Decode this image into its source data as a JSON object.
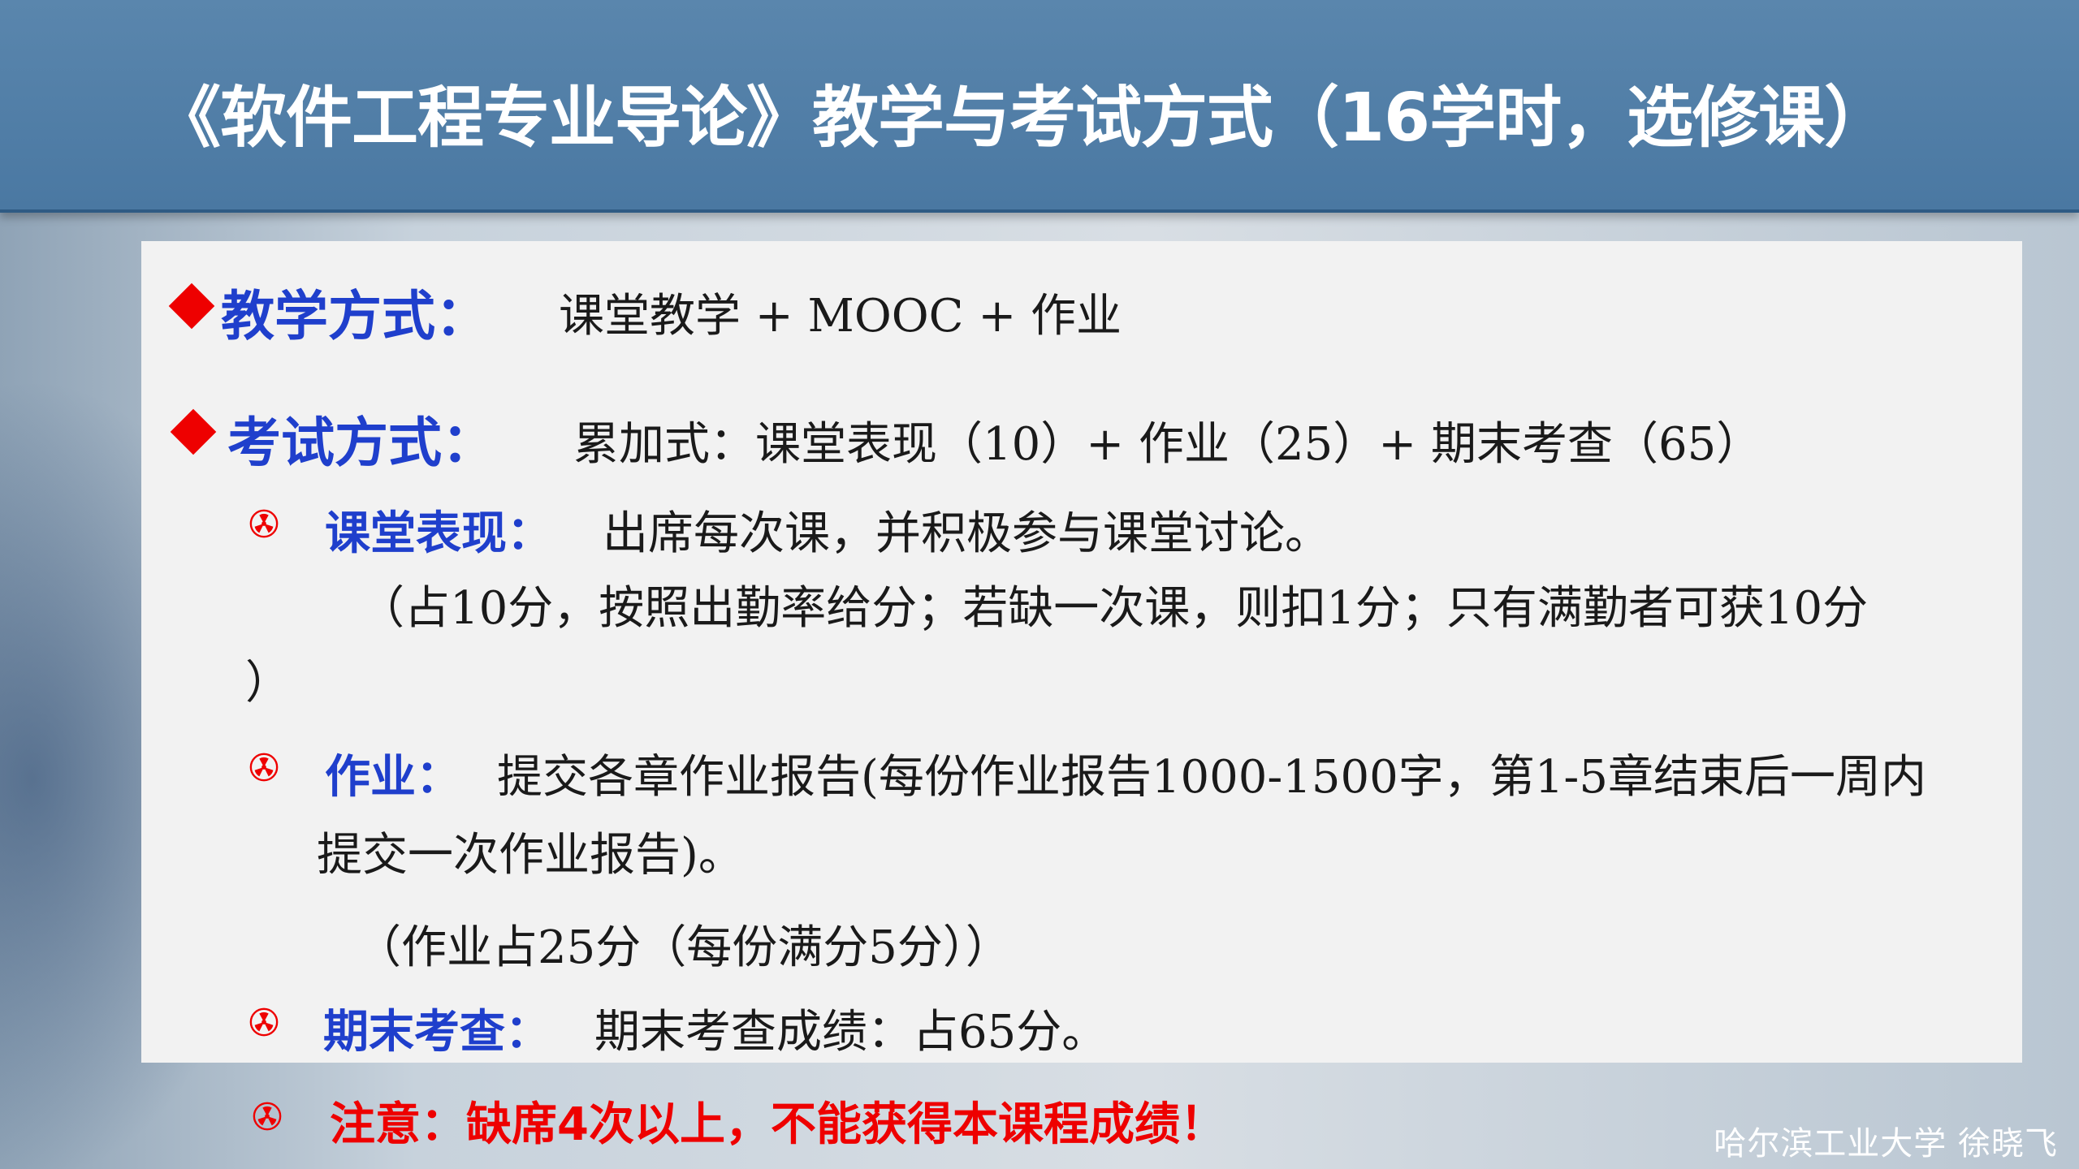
{
  "title": "《软件工程专业导论》教学与考试方式（16学时，选修课）",
  "teaching": {
    "label": "教学方式：",
    "value": "课堂教学 + MOOC + 作业"
  },
  "exam": {
    "label": "考试方式：",
    "value": "累加式：课堂表现（10）+ 作业（25）+ 期末考查（65）"
  },
  "items": [
    {
      "label": "课堂表现：",
      "text": "出席每次课，并积极参与课堂讨论。",
      "detail_line1": "（占10分，按照出勤率给分；若缺一次课，则扣1分；只有满勤者可获10分",
      "detail_line2": "）"
    },
    {
      "label": "作业：",
      "text_line1": "提交各章作业报告(每份作业报告1000-1500字，第1-5章结束后一周内",
      "text_line2": "提交一次作业报告)。",
      "detail": "（作业占25分（每份满分5分））"
    },
    {
      "label": "期末考查：",
      "text": "期末考查成绩：占65分。"
    }
  ],
  "notice": "注意：缺席4次以上，不能获得本课程成绩！",
  "footer": "哈尔滨工业大学  徐晓飞",
  "colors": {
    "header": "#4a78a2",
    "label_blue": "#1f3fcc",
    "accent_red": "#ee0000",
    "panel": "#f2f2f2"
  },
  "icons": {
    "main_bullet": "red-diamond-icon",
    "sub_bullet": "radiation-trefoil-icon"
  }
}
